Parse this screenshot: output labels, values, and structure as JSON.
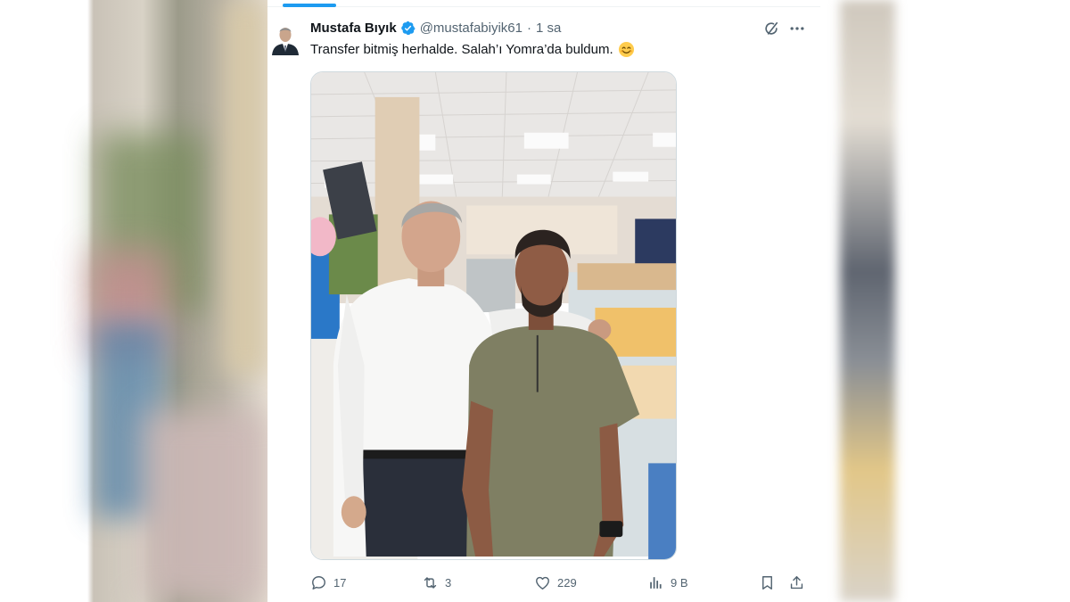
{
  "tweet": {
    "author_name": "Mustafa Bıyık",
    "handle": "@mustafabiyik61",
    "separator": "·",
    "time": "1 sa",
    "text": "Transfer bitmiş herhalde. Salah’ı Yomra’da buldum.",
    "emoji": "smiling-face-emoji",
    "verified": true,
    "accent_color": "#1d9bf0"
  },
  "actions": {
    "replies": "17",
    "retweets": "3",
    "likes": "229",
    "views": "9 B"
  },
  "icons": {
    "reply": "reply-icon",
    "retweet": "retweet-icon",
    "like": "heart-icon",
    "views": "analytics-icon",
    "bookmark": "bookmark-icon",
    "share": "share-icon",
    "grok": "grok-icon",
    "more": "more-icon"
  }
}
